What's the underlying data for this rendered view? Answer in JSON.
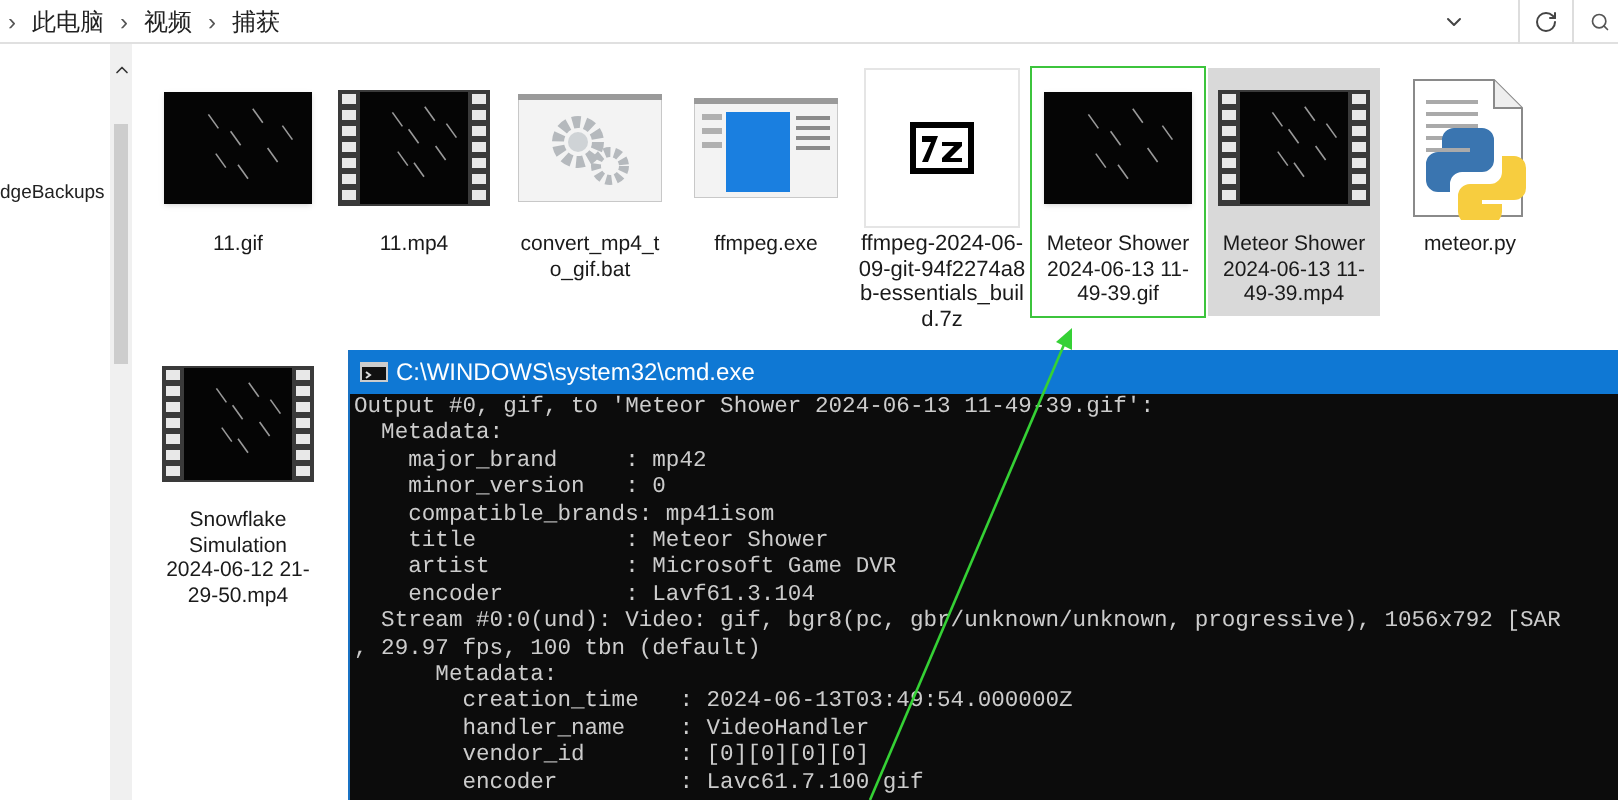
{
  "breadcrumb": [
    {
      "separator": "›",
      "label": "此电脑"
    },
    {
      "separator": "›",
      "label": "视频"
    },
    {
      "separator": "›",
      "label": "捕获"
    }
  ],
  "nav_pane": {
    "items": [
      "dgeBackups"
    ]
  },
  "files": [
    {
      "name": "11.gif",
      "kind": "frame",
      "selected": false,
      "outlined": false
    },
    {
      "name": "11.mp4",
      "kind": "film",
      "selected": false,
      "outlined": false
    },
    {
      "name": "convert_mp4_to_gif.bat",
      "kind": "batch",
      "selected": false,
      "outlined": false
    },
    {
      "name": "ffmpeg.exe",
      "kind": "exe",
      "selected": false,
      "outlined": false
    },
    {
      "name": "ffmpeg-2024-06-09-git-94f2274a8b-essentials_build.7z",
      "kind": "archive",
      "selected": false,
      "outlined": false
    },
    {
      "name": "Meteor Shower 2024-06-13 11-49-39.gif",
      "kind": "frame",
      "selected": false,
      "outlined": true
    },
    {
      "name": "Meteor Shower 2024-06-13 11-49-39.mp4",
      "kind": "film",
      "selected": true,
      "outlined": false
    },
    {
      "name": "meteor.py",
      "kind": "python",
      "selected": false,
      "outlined": false
    },
    {
      "name": "Snowflake Simulation 2024-06-12 21-29-50.mp4",
      "kind": "film",
      "selected": false,
      "outlined": false
    }
  ],
  "console": {
    "title": "C:\\WINDOWS\\system32\\cmd.exe",
    "lines": [
      "Output #0, gif, to 'Meteor Shower 2024-06-13 11-49-39.gif':",
      "  Metadata:",
      "    major_brand     : mp42",
      "    minor_version   : 0",
      "    compatible_brands: mp41isom",
      "    title           : Meteor Shower",
      "    artist          : Microsoft Game DVR",
      "    encoder         : Lavf61.3.104",
      "  Stream #0:0(und): Video: gif, bgr8(pc, gbr/unknown/unknown, progressive), 1056x792 [SAR",
      ", 29.97 fps, 100 tbn (default)",
      "      Metadata:",
      "        creation_time   : 2024-06-13T03:49:54.000000Z",
      "        handler_name    : VideoHandler",
      "        vendor_id       : [0][0][0][0]",
      "        encoder         : Lavc61.7.100 gif"
    ]
  }
}
